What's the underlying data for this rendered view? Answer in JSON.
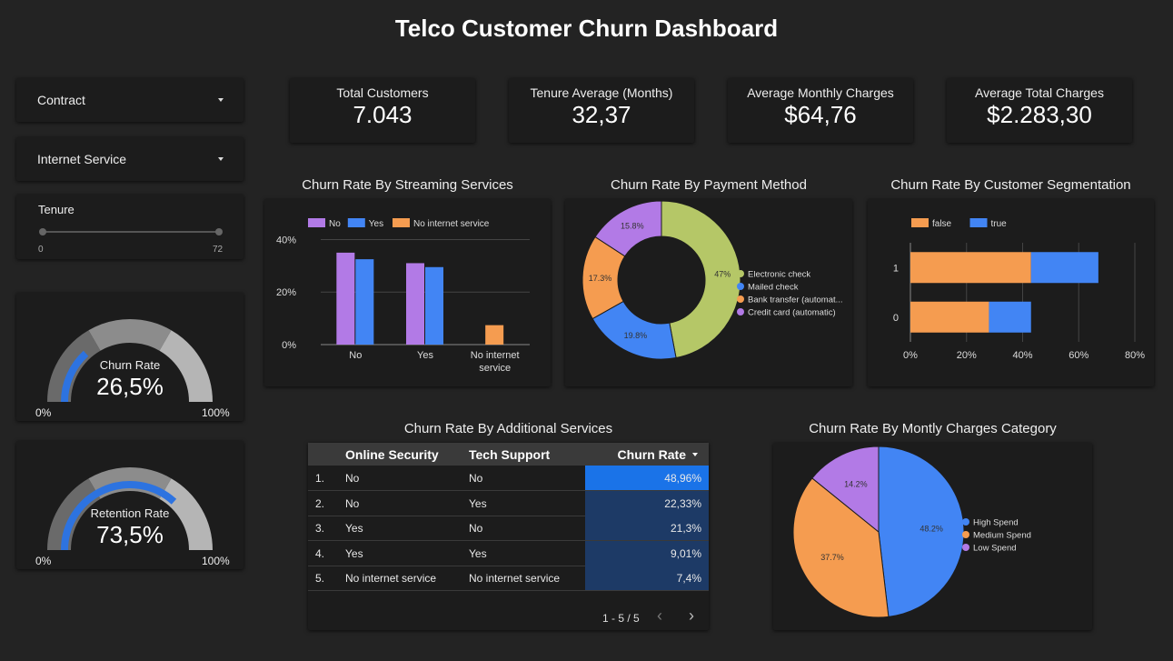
{
  "dashboard": {
    "title": "Telco Customer Churn Dashboard"
  },
  "filters": {
    "contract": {
      "label": "Contract"
    },
    "internet_service": {
      "label": "Internet Service"
    },
    "tenure": {
      "label": "Tenure",
      "min": "0",
      "max": "72"
    }
  },
  "kpis": [
    {
      "label": "Total Customers",
      "value": "7.043"
    },
    {
      "label": "Tenure Average (Months)",
      "value": "32,37"
    },
    {
      "label": "Average Monthly Charges",
      "value": "$64,76"
    },
    {
      "label": "Average Total Charges",
      "value": "$2.283,30"
    }
  ],
  "gauges": {
    "churn": {
      "label": "Churn Rate",
      "value_text": "26,5%",
      "fraction": 0.265,
      "min": "0%",
      "max": "100%"
    },
    "retention": {
      "label": "Retention Rate",
      "value_text": "73,5%",
      "fraction": 0.735,
      "min": "0%",
      "max": "100%"
    }
  },
  "colors": {
    "purple": "#b27ae6",
    "blue": "#4285f4",
    "orange": "#f59c50",
    "green": "#b5c767",
    "gauge_blue": "#2d73e0"
  },
  "chart_data": [
    {
      "id": "streaming",
      "type": "bar",
      "title": "Churn Rate By Streaming Services",
      "categories": [
        "No",
        "Yes",
        "No internet service"
      ],
      "series": [
        {
          "name": "No",
          "values": [
            0.35,
            0.31,
            null
          ]
        },
        {
          "name": "Yes",
          "values": [
            0.325,
            0.295,
            null
          ]
        },
        {
          "name": "No internet service",
          "values": [
            null,
            null,
            0.074
          ]
        }
      ],
      "yticks": [
        "0%",
        "20%",
        "40%"
      ],
      "ylim": [
        0,
        0.45
      ],
      "legend": "top-left",
      "grid": true
    },
    {
      "id": "payment",
      "type": "pie",
      "title": "Churn Rate By Payment Method",
      "donut": true,
      "slices": [
        {
          "name": "Electronic check",
          "value": 47,
          "label": "47%"
        },
        {
          "name": "Mailed check",
          "value": 19.8,
          "label": "19.8%"
        },
        {
          "name": "Bank transfer (automat...",
          "value": 17.3,
          "label": "17.3%"
        },
        {
          "name": "Credit card (automatic)",
          "value": 15.8,
          "label": "15.8%"
        }
      ],
      "legend": "right"
    },
    {
      "id": "segmentation",
      "type": "bar",
      "orientation": "horizontal",
      "stacked": true,
      "title": "Churn Rate By Customer Segmentation",
      "categories": [
        "1",
        "0"
      ],
      "series": [
        {
          "name": "false",
          "values": [
            0.43,
            0.28
          ]
        },
        {
          "name": "true",
          "values": [
            0.24,
            0.15
          ]
        }
      ],
      "xticks": [
        "0%",
        "20%",
        "40%",
        "60%",
        "80%"
      ],
      "xlim": [
        0,
        0.8
      ],
      "legend": "top-left",
      "grid": true
    },
    {
      "id": "monthly",
      "type": "pie",
      "title": "Churn Rate By Montly Charges Category",
      "slices": [
        {
          "name": "High Spend",
          "value": 48.2,
          "label": "48.2%"
        },
        {
          "name": "Medium Spend",
          "value": 37.7,
          "label": "37.7%"
        },
        {
          "name": "Low Spend",
          "value": 14.2,
          "label": "14.2%"
        }
      ],
      "legend": "right"
    },
    {
      "id": "additional",
      "type": "table",
      "title": "Churn Rate By Additional Services",
      "columns": [
        "Online Security",
        "Tech Support",
        "Churn Rate"
      ],
      "rows": [
        {
          "idx": "1.",
          "security": "No",
          "support": "No",
          "rate": "48,96%",
          "value": 48.96
        },
        {
          "idx": "2.",
          "security": "No",
          "support": "Yes",
          "rate": "22,33%",
          "value": 22.33
        },
        {
          "idx": "3.",
          "security": "Yes",
          "support": "No",
          "rate": "21,3%",
          "value": 21.3
        },
        {
          "idx": "4.",
          "security": "Yes",
          "support": "Yes",
          "rate": "9,01%",
          "value": 9.01
        },
        {
          "idx": "5.",
          "security": "No internet service",
          "support": "No internet service",
          "rate": "7,4%",
          "value": 7.4
        }
      ],
      "pagination": "1 - 5 / 5"
    }
  ]
}
